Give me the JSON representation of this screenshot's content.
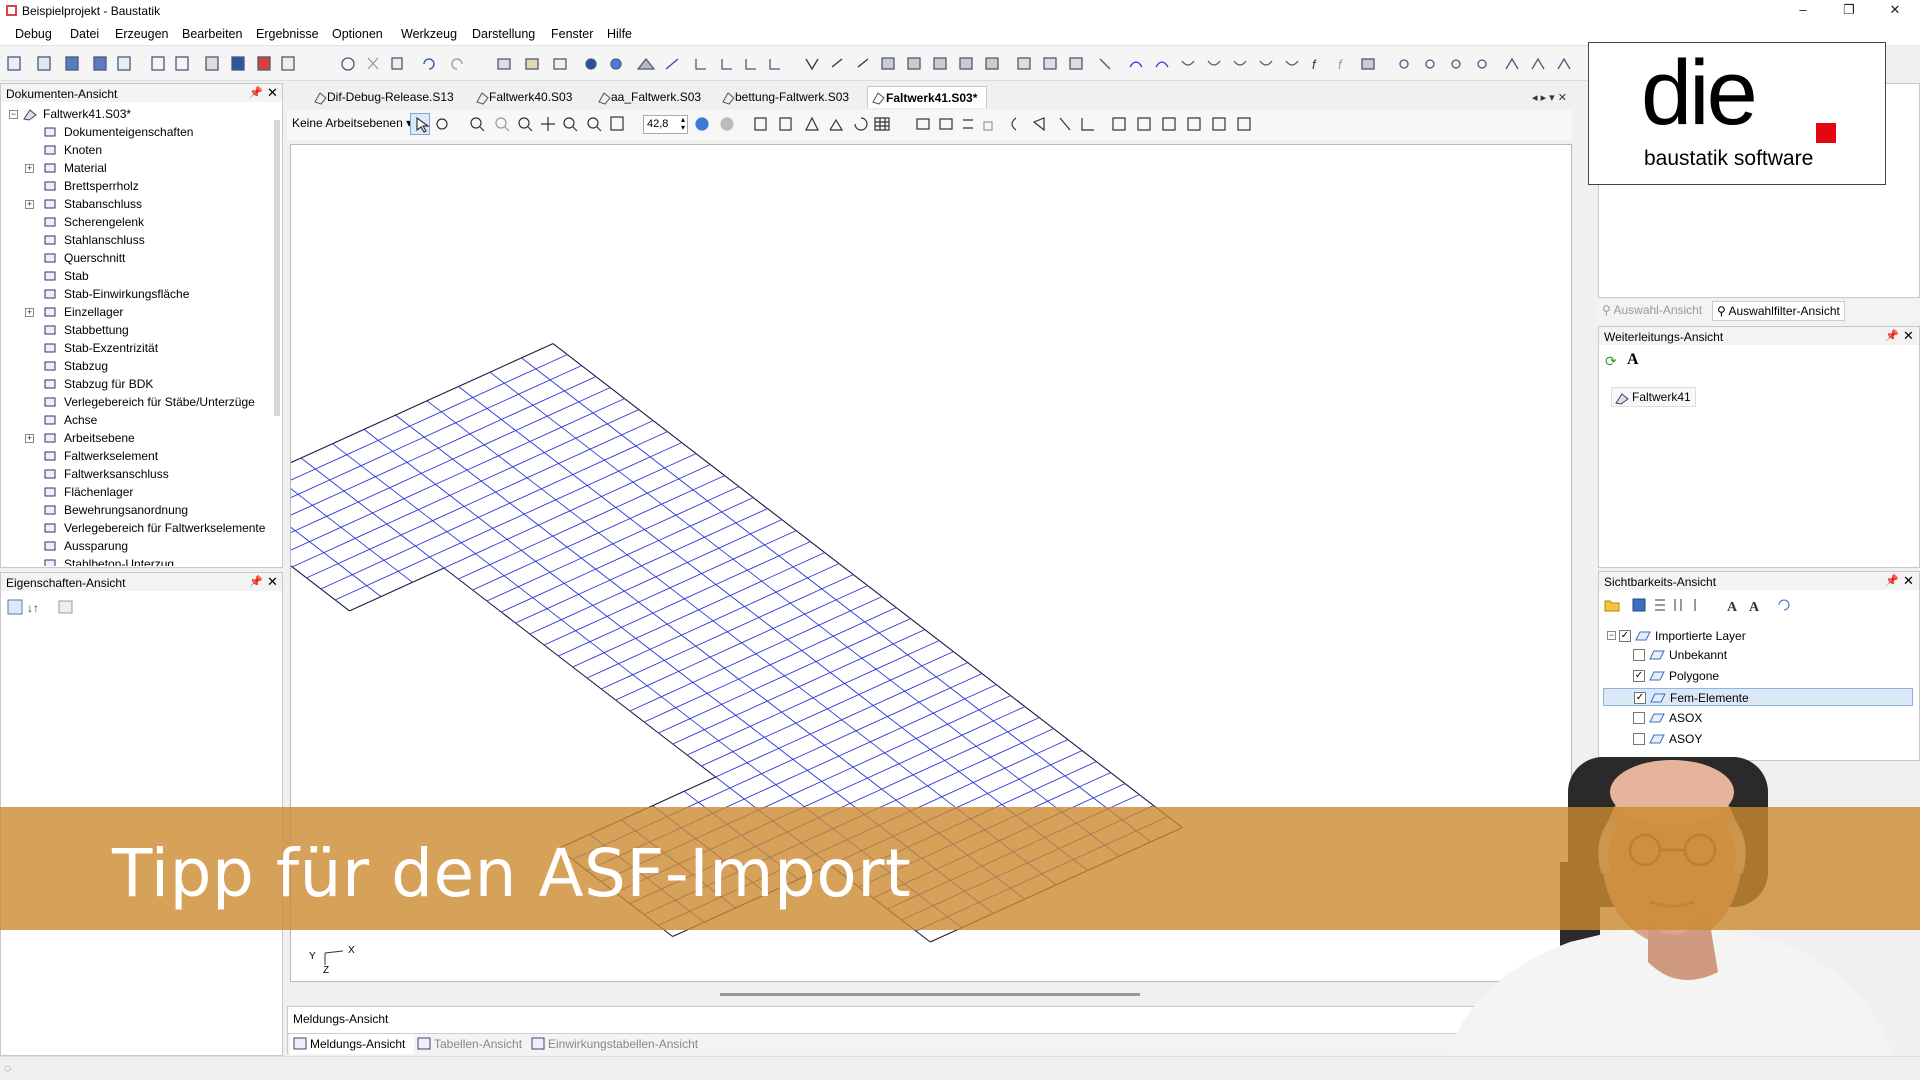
{
  "window": {
    "title": "Beispielprojekt - Baustatik",
    "minimize": "–",
    "maximize": "❐",
    "close": "✕"
  },
  "menu": [
    "Debug",
    "Datei",
    "Erzeugen",
    "Bearbeiten",
    "Ergebnisse",
    "Optionen",
    "Werkzeug",
    "Darstellung",
    "Fenster",
    "Hilfe"
  ],
  "document_view": {
    "title": "Dokumenten-Ansicht",
    "root": "Faltwerk41.S03*",
    "items": [
      {
        "label": "Dokumenteigenschaften",
        "icon": "document-properties-icon",
        "expandable": false
      },
      {
        "label": "Knoten",
        "icon": "node-icon",
        "expandable": false
      },
      {
        "label": "Material",
        "icon": "material-icon",
        "expandable": true
      },
      {
        "label": "Brettsperrholz",
        "icon": "clt-panel-icon",
        "expandable": false
      },
      {
        "label": "Stabanschluss",
        "icon": "member-connection-icon",
        "expandable": true
      },
      {
        "label": "Scherengelenk",
        "icon": "scissor-joint-icon",
        "expandable": false
      },
      {
        "label": "Stahlanschluss",
        "icon": "steel-connection-icon",
        "expandable": false
      },
      {
        "label": "Querschnitt",
        "icon": "cross-section-icon",
        "expandable": false
      },
      {
        "label": "Stab",
        "icon": "member-icon",
        "expandable": false
      },
      {
        "label": "Stab-Einwirkungsfläche",
        "icon": "member-load-area-icon",
        "expandable": false
      },
      {
        "label": "Einzellager",
        "icon": "single-support-icon",
        "expandable": true
      },
      {
        "label": "Stabbettung",
        "icon": "member-bedding-icon",
        "expandable": false
      },
      {
        "label": "Stab-Exzentrizität",
        "icon": "member-eccentricity-icon",
        "expandable": false
      },
      {
        "label": "Stabzug",
        "icon": "member-chain-icon",
        "expandable": false
      },
      {
        "label": "Stabzug für BDK",
        "icon": "member-chain-bdk-icon",
        "expandable": false
      },
      {
        "label": "Verlegebereich für Stäbe/Unterzüge",
        "icon": "laying-area-icon",
        "expandable": false
      },
      {
        "label": "Achse",
        "icon": "axis-icon",
        "expandable": false
      },
      {
        "label": "Arbeitsebene",
        "icon": "work-plane-icon",
        "expandable": true
      },
      {
        "label": "Faltwerkselement",
        "icon": "folded-plate-element-icon",
        "expandable": false
      },
      {
        "label": "Faltwerksanschluss",
        "icon": "folded-plate-connection-icon",
        "expandable": false
      },
      {
        "label": "Flächenlager",
        "icon": "area-support-icon",
        "expandable": false
      },
      {
        "label": "Bewehrungsanordnung",
        "icon": "reinforcement-layout-icon",
        "expandable": false
      },
      {
        "label": "Verlegebereich für Faltwerkselemente",
        "icon": "plate-laying-area-icon",
        "expandable": false
      },
      {
        "label": "Aussparung",
        "icon": "opening-icon",
        "expandable": false
      },
      {
        "label": "Stahlbeton-Unterzug",
        "icon": "rc-beam-icon",
        "expandable": false
      }
    ]
  },
  "properties_view": {
    "title": "Eigenschaften-Ansicht"
  },
  "doc_tabs": [
    {
      "label": "Dif-Debug-Release.S13",
      "active": false
    },
    {
      "label": "Faltwerk40.S03",
      "active": false
    },
    {
      "label": "aa_Faltwerk.S03",
      "active": false
    },
    {
      "label": "bettung-Faltwerk.S03",
      "active": false
    },
    {
      "label": "Faltwerk41.S03*",
      "active": true
    }
  ],
  "view_toolbar": {
    "work_plane": "Keine Arbeitsebenen",
    "zoom_value": "42,8"
  },
  "axis_labels": {
    "x": "X",
    "y": "Y",
    "z": "Z"
  },
  "message_view": {
    "title": "Meldungs-Ansicht"
  },
  "bottom_tabs": [
    "Meldungs-Ansicht",
    "Tabellen-Ansicht",
    "Einwirkungstabellen-Ansicht"
  ],
  "selection_tabs": [
    "Auswahl-Ansicht",
    "Auswahlfilter-Ansicht"
  ],
  "forwarding_view": {
    "title": "Weiterleitungs-Ansicht",
    "item": "Faltwerk41"
  },
  "visibility_view": {
    "title": "Sichtbarkeits-Ansicht",
    "root": "Importierte Layer",
    "layers": [
      {
        "label": "Unbekannt",
        "checked": false,
        "selected": false
      },
      {
        "label": "Polygone",
        "checked": true,
        "selected": false
      },
      {
        "label": "Fem-Elemente",
        "checked": true,
        "selected": true
      },
      {
        "label": "ASOX",
        "checked": false,
        "selected": false
      },
      {
        "label": "ASOY",
        "checked": false,
        "selected": false
      }
    ]
  },
  "logo": {
    "main": "die",
    "sub": "baustatik software",
    "accent": "#e30613"
  },
  "banner": {
    "text": "Tipp für den ASF-Import",
    "color": "#cc8a30"
  },
  "colors": {
    "mesh_blue": "#2a35d6",
    "mesh_dark": "#1a1a40"
  }
}
